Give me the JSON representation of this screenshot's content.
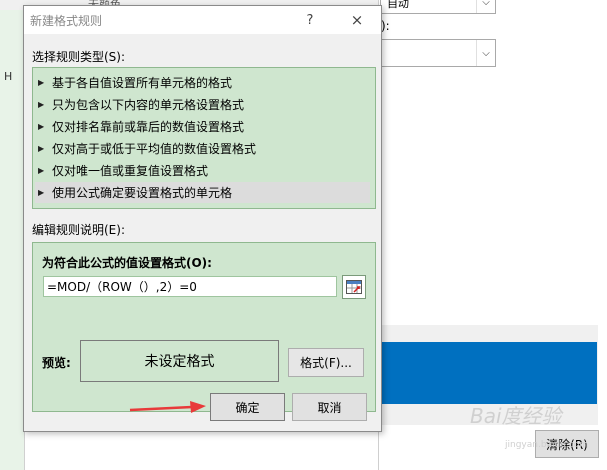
{
  "background": {
    "top_left_fragment": "无颜色",
    "top_right_fragment": "自动",
    "left_column_letter": "H",
    "right_label": "):",
    "clear_button": "清除(R)",
    "preview_fill_color": "#0070c0"
  },
  "dialog": {
    "title": "新建格式规则",
    "help_icon": "?",
    "close_icon": "×",
    "select_rule_type_label": "选择规则类型(S):",
    "rule_types": [
      "基于各自值设置所有单元格的格式",
      "只为包含以下内容的单元格设置格式",
      "仅对排名靠前或靠后的数值设置格式",
      "仅对高于或低于平均值的数值设置格式",
      "仅对唯一值或重复值设置格式",
      "使用公式确定要设置格式的单元格"
    ],
    "selected_rule_index": 5,
    "edit_rule_label": "编辑规则说明(E):",
    "formula_heading": "为符合此公式的值设置格式(O):",
    "formula_value": "=MOD/（ROW（）,2）=0",
    "preview_label": "预览:",
    "preview_text": "未设定格式",
    "format_button": "格式(F)...",
    "ok_button": "确定",
    "cancel_button": "取消",
    "list_bg_color": "#cfe6cf",
    "annotation_arrow_color": "#e83a3a"
  },
  "watermark": {
    "text": "Bai度经验",
    "sub": "jingyan.baidu.com"
  }
}
